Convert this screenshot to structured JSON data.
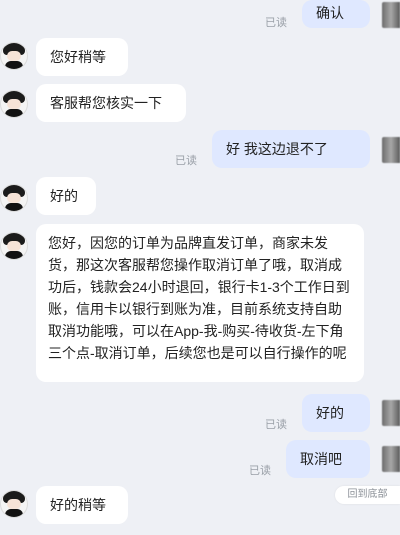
{
  "messages": {
    "m1": {
      "text": "确认",
      "read": "已读"
    },
    "m2": {
      "text": "您好稍等"
    },
    "m3": {
      "text": "客服帮您核实一下"
    },
    "m4": {
      "text": "好 我这边退不了",
      "read": "已读"
    },
    "m5": {
      "text": "好的"
    },
    "m6": {
      "text": "您好，因您的订单为品牌直发订单，商家未发货，那这次客服帮您操作取消订单了哦，取消成功后，钱款会24小时退回，银行卡1-3个工作日到账，信用卡以银行到账为准，目前系统支持自助取消功能哦，可以在App-我-购买-待收货-左下角三个点-取消订单，后续您也是可以自行操作的呢"
    },
    "m7": {
      "text": "好的",
      "read": "已读"
    },
    "m8": {
      "text": "取消吧",
      "read": "已读"
    },
    "m9": {
      "text": "好的稍等"
    }
  },
  "scroll_button": {
    "label": "回到底部"
  },
  "colors": {
    "background": "#eef0f5",
    "user_bubble": "#dfe8ff",
    "agent_bubble": "#ffffff"
  }
}
